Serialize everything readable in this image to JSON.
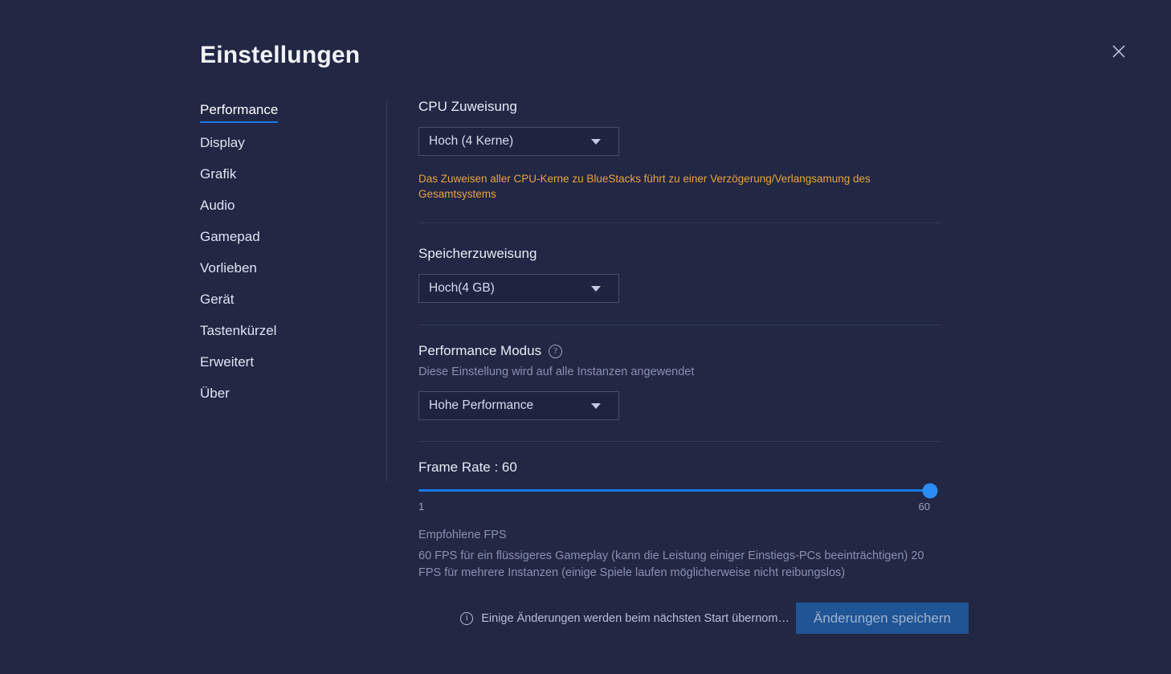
{
  "window": {
    "title": "Einstellungen",
    "close_icon": "close-icon"
  },
  "sidebar": {
    "items": [
      {
        "label": "Performance",
        "active": true
      },
      {
        "label": "Display",
        "active": false
      },
      {
        "label": "Grafik",
        "active": false
      },
      {
        "label": "Audio",
        "active": false
      },
      {
        "label": "Gamepad",
        "active": false
      },
      {
        "label": "Vorlieben",
        "active": false
      },
      {
        "label": "Gerät",
        "active": false
      },
      {
        "label": "Tastenkürzel",
        "active": false
      },
      {
        "label": "Erweitert",
        "active": false
      },
      {
        "label": "Über",
        "active": false
      }
    ]
  },
  "main": {
    "cpu": {
      "label": "CPU Zuweisung",
      "selected": "Hoch (4 Kerne)",
      "warning": "Das Zuweisen aller CPU-Kerne zu BlueStacks  führt zu einer Verzögerung/Verlangsamung des Gesamtsystems"
    },
    "memory": {
      "label": "Speicherzuweisung",
      "selected": "Hoch(4 GB)"
    },
    "performance_mode": {
      "label": "Performance Modus",
      "help_icon": "?",
      "description": "Diese Einstellung wird auf alle Instanzen angewendet",
      "selected": "Hohe Performance"
    },
    "frame_rate": {
      "label": "Frame Rate : 60",
      "value": 60,
      "min": 1,
      "max": 60,
      "min_label": "1",
      "max_label": "60",
      "recommended_heading": "Empfohlene FPS",
      "recommended_body": "60 FPS für ein flüssigeres Gameplay (kann die Leistung einiger Einstiegs-PCs beeinträchtigen) 20 FPS für mehrere Instanzen (einige Spiele laufen möglicherweise nicht reibungslos)"
    }
  },
  "footer": {
    "info_icon": "i",
    "note": "Einige Änderungen werden beim nächsten Start übernom…",
    "save_label": "Änderungen speichern"
  },
  "colors": {
    "background": "#222744",
    "accent_blue": "#1a7ae8",
    "slider_thumb": "#2a8cf0",
    "warning_orange": "#e8a33d",
    "save_button": "#1f5495"
  }
}
